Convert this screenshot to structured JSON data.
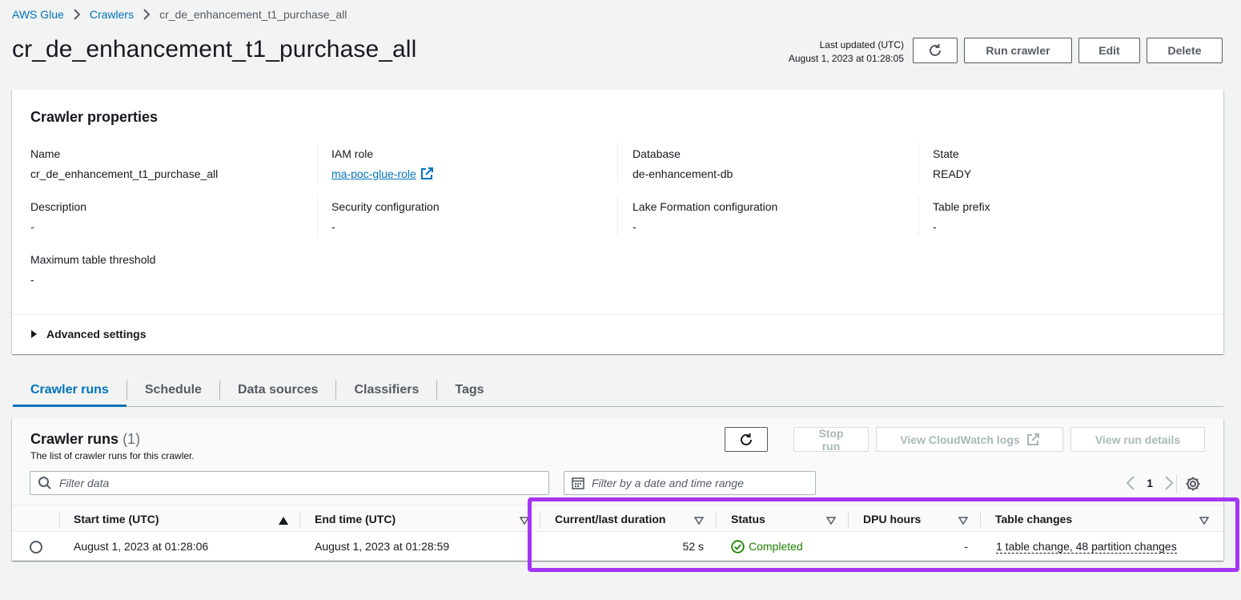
{
  "breadcrumb": {
    "items": [
      "AWS Glue",
      "Crawlers"
    ],
    "current": "cr_de_enhancement_t1_purchase_all"
  },
  "header": {
    "title": "cr_de_enhancement_t1_purchase_all",
    "last_updated_label": "Last updated (UTC)",
    "last_updated_value": "August 1, 2023 at 01:28:05",
    "run_label": "Run crawler",
    "edit_label": "Edit",
    "delete_label": "Delete",
    "refresh_icon": "refresh-icon"
  },
  "properties": {
    "title": "Crawler properties",
    "name_label": "Name",
    "name_value": "cr_de_enhancement_t1_purchase_all",
    "iam_label": "IAM role",
    "iam_value": "ma-poc-glue-role",
    "db_label": "Database",
    "db_value": "de-enhancement-db",
    "state_label": "State",
    "state_value": "READY",
    "desc_label": "Description",
    "desc_value": "-",
    "sec_label": "Security configuration",
    "sec_value": "-",
    "lake_label": "Lake Formation configuration",
    "lake_value": "-",
    "prefix_label": "Table prefix",
    "prefix_value": "-",
    "max_label": "Maximum table threshold",
    "max_value": "-",
    "advanced_label": "Advanced settings"
  },
  "tabs": [
    "Crawler runs",
    "Schedule",
    "Data sources",
    "Classifiers",
    "Tags"
  ],
  "runs": {
    "title": "Crawler runs",
    "count": "(1)",
    "description": "The list of crawler runs for this crawler.",
    "stop_label": "Stop run",
    "cloudwatch_label": "View CloudWatch logs",
    "details_label": "View run details",
    "filter_placeholder": "Filter data",
    "date_placeholder": "Filter by a date and time range",
    "page": "1",
    "columns": [
      "Start time (UTC)",
      "End time (UTC)",
      "Current/last duration",
      "Status",
      "DPU hours",
      "Table changes"
    ],
    "rows": [
      {
        "start": "August 1, 2023 at 01:28:06",
        "end": "August 1, 2023 at 01:28:59",
        "duration": "52 s",
        "status": "Completed",
        "dpu": "-",
        "changes": "1 table change, 48 partition changes"
      }
    ]
  },
  "colors": {
    "link": "#0073bb",
    "success": "#1d8102",
    "highlight": "#a535f4"
  }
}
